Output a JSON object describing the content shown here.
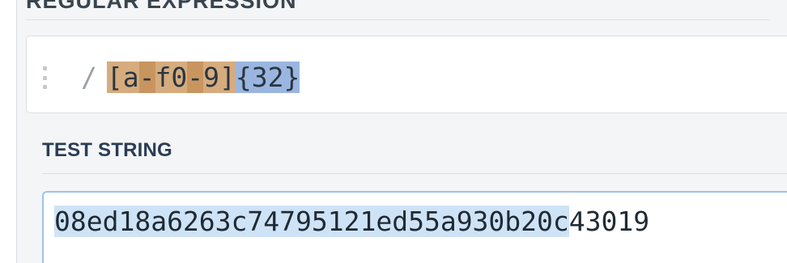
{
  "regex_section": {
    "title": "REGULAR EXPRESSION",
    "delimiter": "/",
    "tokens": {
      "open": "[",
      "a": "a",
      "dash1": "-",
      "f": "f",
      "zero": "0",
      "dash2": "-",
      "nine": "9",
      "close": "]",
      "quantifier": "{32}"
    }
  },
  "test_section": {
    "title": "TEST STRING",
    "matched_text": "08ed18a6263c74795121ed55a930b20c",
    "trailing_text": "43019"
  },
  "colors": {
    "char_class_light": "#d6ac7e",
    "char_class_dark": "#c9955f",
    "quantifier": "#9ab6e0",
    "match_highlight": "#cfe3f7",
    "focus_border": "#9dc3ea"
  }
}
